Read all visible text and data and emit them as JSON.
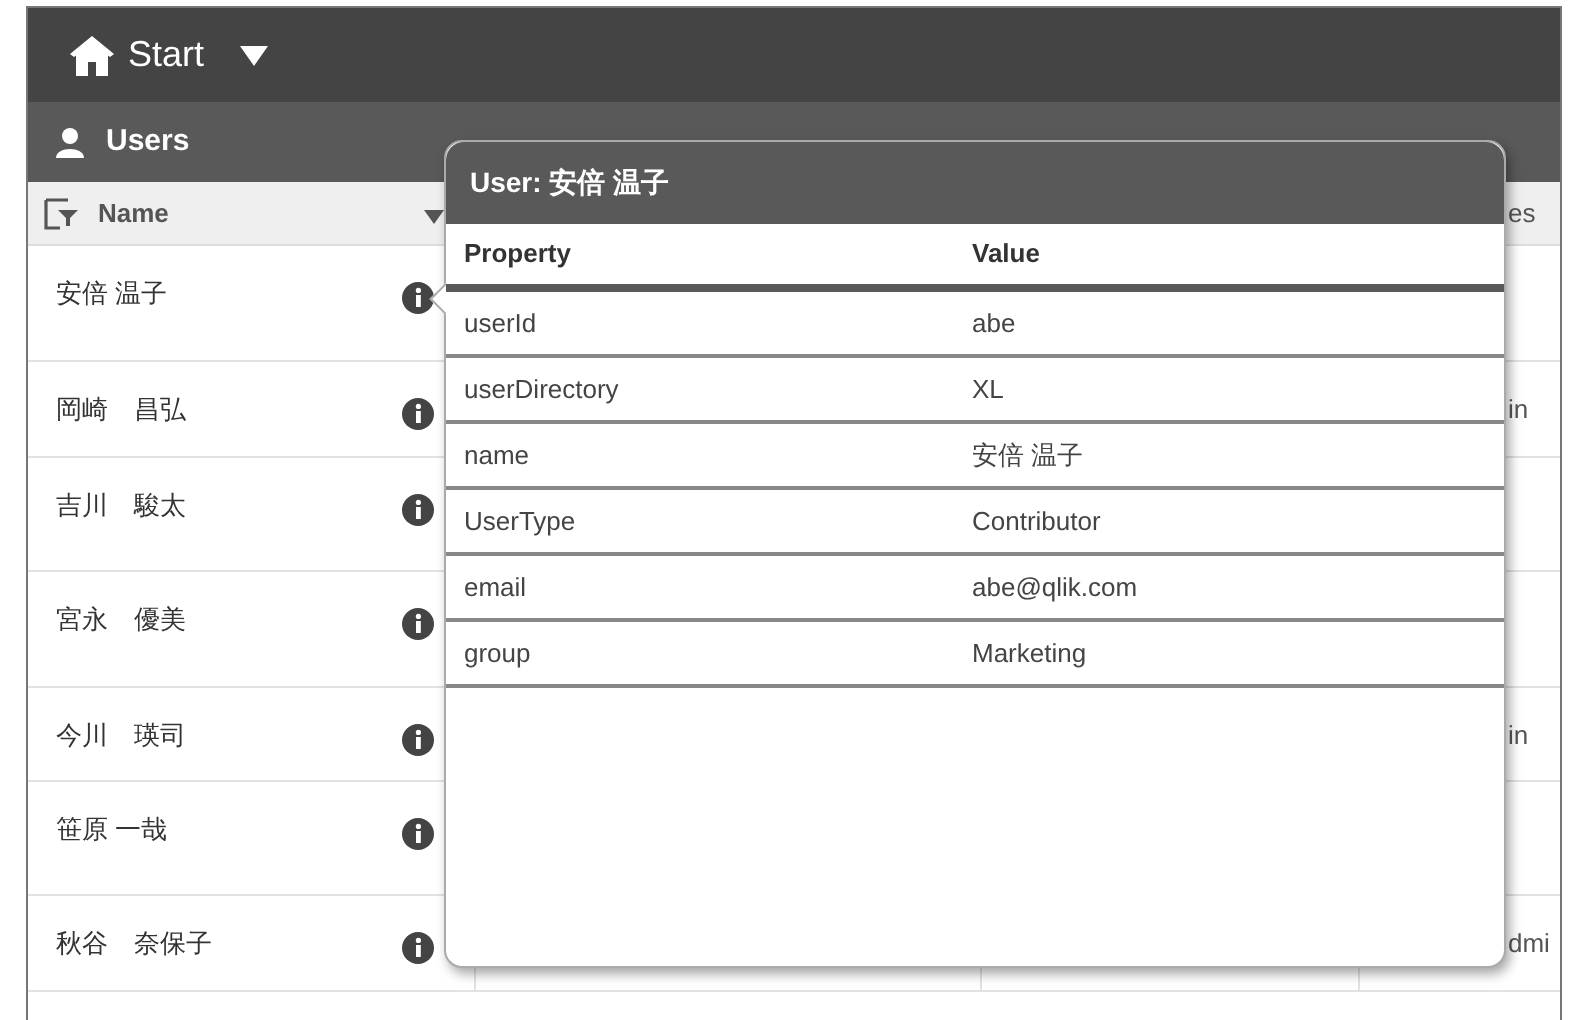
{
  "top_bar": {
    "title": "Start"
  },
  "section": {
    "title": "Users"
  },
  "table": {
    "name_header": "Name",
    "column_4_header": "es",
    "rows": [
      {
        "name": "安倍 温子"
      },
      {
        "name": "岡崎　昌弘",
        "column_4": "in"
      },
      {
        "name": "吉川　駿太"
      },
      {
        "name": "宮永　優美"
      },
      {
        "name": "今川　瑛司",
        "column_4": "in"
      },
      {
        "name": "笹原 一哉"
      },
      {
        "name": "秋谷　奈保子",
        "column_4": "dmi"
      }
    ]
  },
  "popup": {
    "title": "User: 安倍 温子",
    "columns": [
      "Property",
      "Value"
    ],
    "rows": [
      {
        "property": "userId",
        "value": "abe"
      },
      {
        "property": "userDirectory",
        "value": "XL"
      },
      {
        "property": "name",
        "value": "安倍 温子"
      },
      {
        "property": "UserType",
        "value": "Contributor"
      },
      {
        "property": "email",
        "value": "abe@qlik.com"
      },
      {
        "property": "group",
        "value": "Marketing"
      }
    ]
  }
}
